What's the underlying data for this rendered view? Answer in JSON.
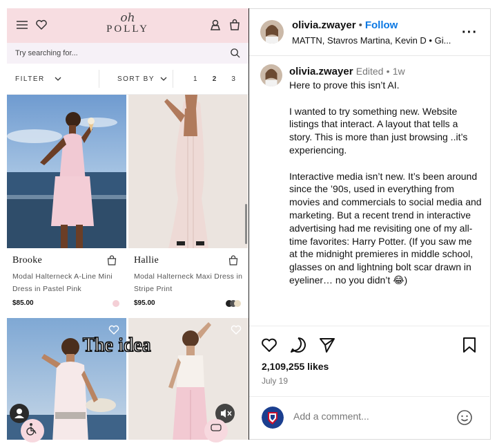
{
  "store": {
    "logo_script": "oh",
    "logo_word": "POLLY",
    "search_placeholder": "Try searching for...",
    "filter_label": "FILTER",
    "sort_label": "SORT BY",
    "pages": [
      "1",
      "2",
      "3"
    ],
    "active_page": "2",
    "products": [
      {
        "name": "Brooke",
        "desc": "Modal Halterneck A-Line Mini Dress in Pastel Pink",
        "price": "$85.00",
        "swatches": [
          "#f4cfd6"
        ]
      },
      {
        "name": "Hallie",
        "desc": "Modal Halterneck Maxi Dress in Stripe Print",
        "price": "$95.00",
        "swatches": [
          "#222222",
          "#555555",
          "#e8dcc4"
        ]
      }
    ],
    "overlay_caption": "The idea",
    "colors": {
      "header_bg": "#f7dde1",
      "search_bg": "#f6f1f7"
    }
  },
  "post": {
    "username": "olivia.zwayer",
    "follow_label": "Follow",
    "collaborators": "MATTN, Stavros Martina, Kevin D • Gi...",
    "more_icon": "more-horizontal-icon",
    "caption_user": "olivia.zwayer",
    "caption_edited": "Edited",
    "caption_age": "1w",
    "caption_text": "Here to prove this isn’t AI.\n\nI wanted to try something new. Website listings that interact. A layout that tells a story. This is more than just browsing ..it’s experiencing.\n\nInteractive media isn’t new. It’s been around since the ’90s, used in everything from movies and commercials to social media and marketing. But a recent trend in interactive advertising had me revisiting one of my all-time favorites: Harry Potter. (If you saw me at the midnight premieres in middle school, glasses on and lightning bolt scar drawn in eyeliner… no you didn’t 😂)",
    "likes": "2,109,255 likes",
    "date": "July 19",
    "comment_placeholder": "Add a comment...",
    "colors": {
      "follow": "#0b78e3"
    }
  }
}
